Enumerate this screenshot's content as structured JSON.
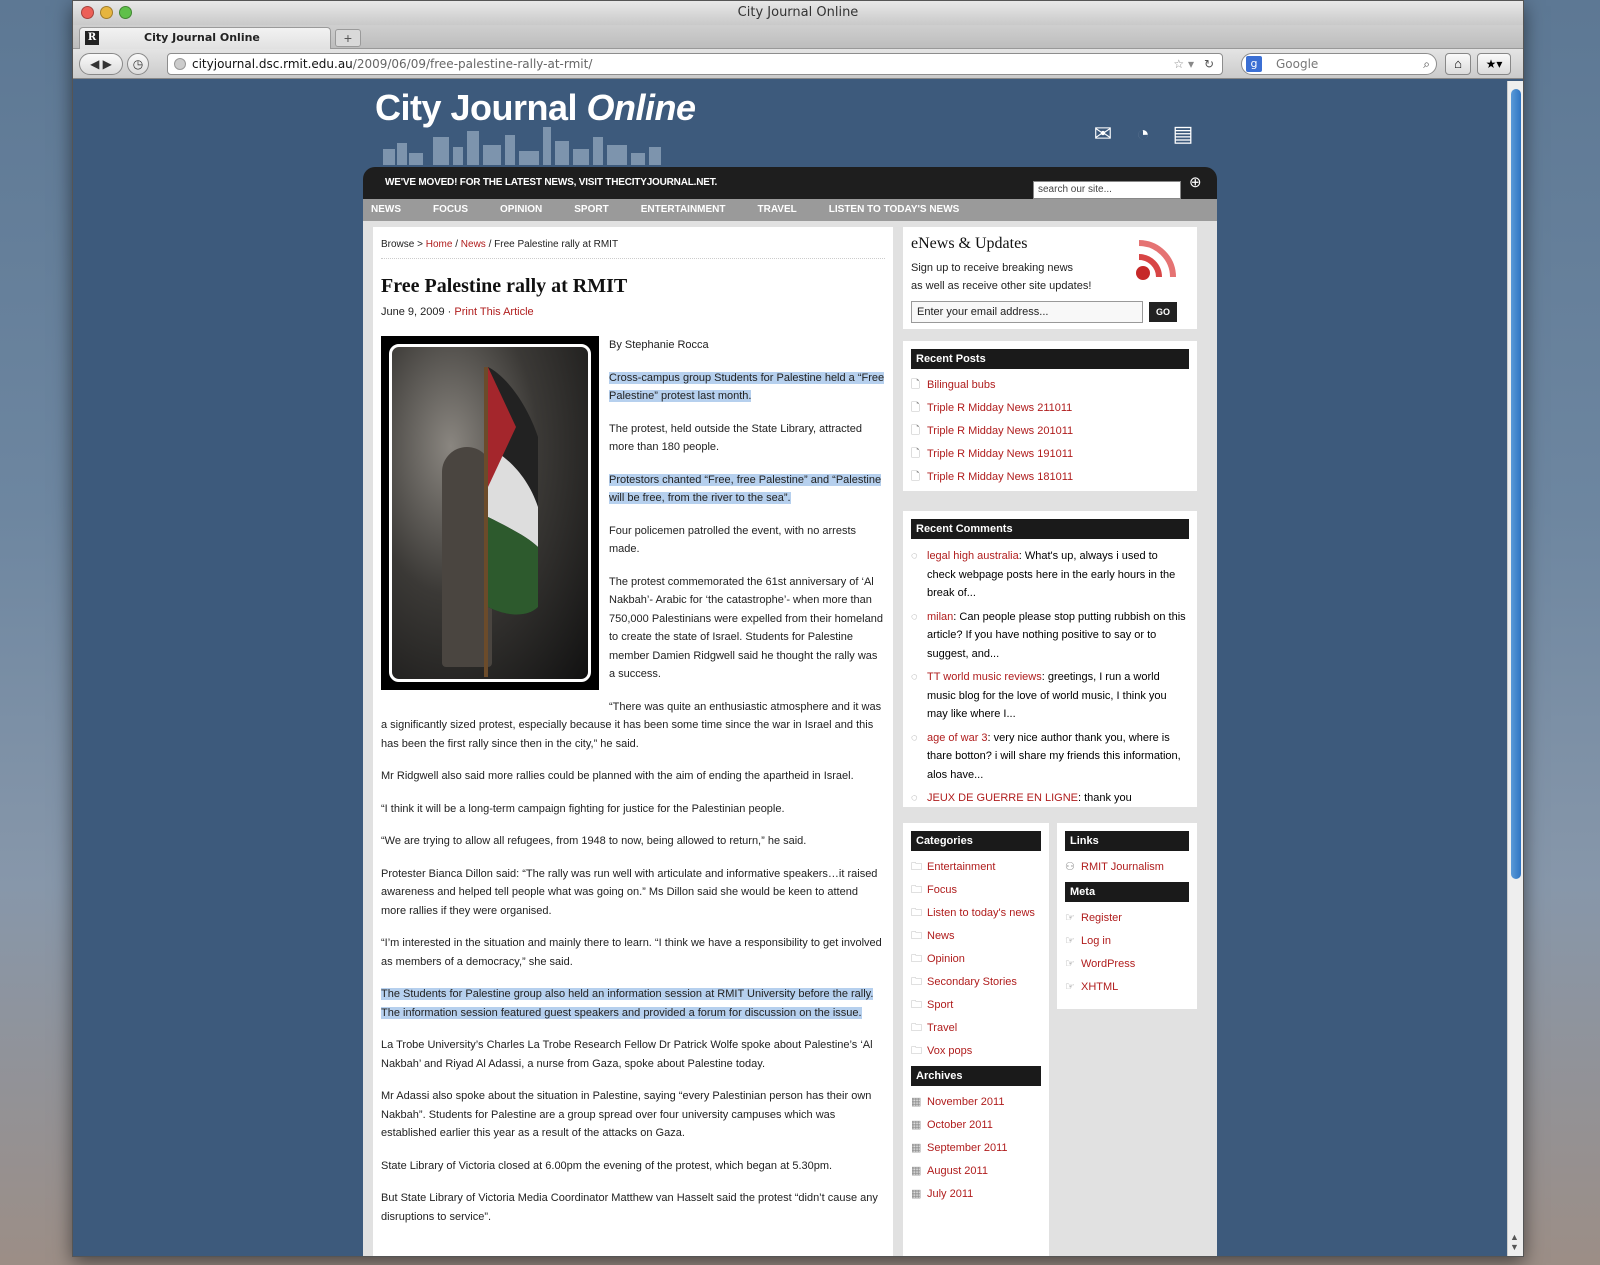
{
  "window": {
    "title": "City Journal Online",
    "tab_label": "City Journal Online",
    "favicon_letter": "R",
    "newtab_label": "+"
  },
  "toolbar": {
    "url_host": "cityjournal.dsc.rmit.edu.au",
    "url_path": "/2009/06/09/free-palestine-rally-at-rmit/",
    "search_placeholder": "Google",
    "search_engine_letter": "g"
  },
  "site": {
    "logo_part1": "City Journal ",
    "logo_part2": "Online",
    "moved_notice": "WE'VE MOVED! FOR THE LATEST NEWS, VISIT THECITYJOURNAL.NET.",
    "search_placeholder": "search our site...",
    "menu": [
      "NEWS",
      "FOCUS",
      "OPINION",
      "SPORT",
      "ENTERTAINMENT",
      "TRAVEL",
      "LISTEN TO TODAY'S NEWS"
    ]
  },
  "breadcrumb": {
    "prefix": "Browse > ",
    "home": "Home",
    "sep1": " / ",
    "news": "News",
    "sep2": " / ",
    "current": "Free Palestine rally at RMIT"
  },
  "article": {
    "title": "Free Palestine rally at RMIT",
    "date": "June 9, 2009 · ",
    "print_link": "Print This Article",
    "byline": "By Stephanie Rocca",
    "paragraphs": [
      {
        "text": "Cross-campus group Students for Palestine held a “Free Palestine” protest last month.",
        "highlight": true
      },
      {
        "text": "The protest, held outside the State Library, attracted more than 180 people.",
        "highlight": false
      },
      {
        "text": "Protestors chanted “Free, free Palestine” and “Palestine will be free, from the river to the sea”.",
        "highlight": true
      },
      {
        "text": "Four policemen patrolled the event, with no arrests made.",
        "highlight": false
      },
      {
        "text": "The protest commemorated the 61st anniversary of ‘Al Nakbah’- Arabic for ‘the catastrophe’- when more than 750,000 Palestinians were expelled from their homeland to create the state of Israel. Students for Palestine member Damien Ridgwell said he thought the rally was a success.",
        "highlight": false
      },
      {
        "text": "“There was quite an enthusiastic atmosphere and it was a significantly sized protest, especially because it has been some time since the war in Israel and this has been the first rally since then in the city,” he said.",
        "highlight": false
      },
      {
        "text": "Mr Ridgwell also said more rallies could be planned with the aim of ending the apartheid in Israel.",
        "highlight": false
      },
      {
        "text": "“I think it will be a long-term campaign fighting for justice for the Palestinian people.",
        "highlight": false
      },
      {
        "text": "“We are trying to allow all refugees, from 1948 to now, being allowed to return,” he said.",
        "highlight": false
      },
      {
        "text": "Protester Bianca Dillon said: “The rally was run well with articulate and informative speakers…it raised awareness and helped tell people what was going on.” Ms Dillon said she would be keen to attend more rallies if they were organised.",
        "highlight": false
      },
      {
        "text": "“I’m interested in the situation and mainly there to learn. “I think we have a responsibility to get involved as members of a democracy,” she said.",
        "highlight": false
      },
      {
        "text": "The Students for Palestine group also held an information session at RMIT University before the rally. The information session featured guest speakers and provided a forum for discussion on the issue.",
        "highlight": true
      },
      {
        "text": "La Trobe University’s Charles La Trobe Research Fellow Dr Patrick Wolfe  spoke about Palestine’s ‘Al Nakbah’ and Riyad Al Adassi, a nurse from Gaza, spoke about Palestine today.",
        "highlight": false
      },
      {
        "text": "Mr Adassi also spoke about the situation in Palestine, saying “every Palestinian person has their own Nakbah”.  Students for Palestine are a group spread over four university campuses which was established earlier this year as a result of the attacks on Gaza.",
        "highlight": false
      },
      {
        "text": "State Library of Victoria closed at 6.00pm the evening of the protest, which began at 5.30pm.",
        "highlight": false
      },
      {
        "text": "But State Library of Victoria Media Coordinator Matthew van Hasselt said the protest “didn’t cause any disruptions to service”.",
        "highlight": false
      }
    ]
  },
  "enews": {
    "title": "eNews & Updates",
    "line1": "Sign up to receive breaking news",
    "line2": "as well as receive other site updates!",
    "email_placeholder": "Enter your email address...",
    "go_label": "GO"
  },
  "recent_posts": {
    "title": "Recent Posts",
    "items": [
      "Bilingual bubs",
      "Triple R Midday News 211011",
      "Triple R Midday News 201011",
      "Triple R Midday News 191011",
      "Triple R Midday News 181011"
    ]
  },
  "recent_comments": {
    "title": "Recent Comments",
    "items": [
      {
        "author": "legal high australia",
        "text": ": What's up, always i used to check webpage posts here in the early hours in the break of..."
      },
      {
        "author": "milan",
        "text": ": Can people please stop putting rubbish on this article? If you have nothing positive to say or to suggest, and..."
      },
      {
        "author": "TT world music reviews",
        "text": ": greetings, I run a world music blog for the love of world music, I think you may like where I..."
      },
      {
        "author": "age of war 3",
        "text": ": very nice author thank you, where is thare botton? i will share my friends this information, alos have..."
      },
      {
        "author": "JEUX DE GUERRE EN LIGNE",
        "text": ": thank you"
      }
    ]
  },
  "categories": {
    "title": "Categories",
    "items": [
      "Entertainment",
      "Focus",
      "Listen to today's news",
      "News",
      "Opinion",
      "Secondary Stories",
      "Sport",
      "Travel",
      "Vox pops"
    ]
  },
  "archives": {
    "title": "Archives",
    "items": [
      "November 2011",
      "October 2011",
      "September 2011",
      "August 2011",
      "July 2011"
    ]
  },
  "links": {
    "title": "Links",
    "items": [
      "RMIT Journalism"
    ]
  },
  "meta": {
    "title": "Meta",
    "items": [
      "Register",
      "Log in",
      "WordPress",
      "XHTML"
    ]
  }
}
